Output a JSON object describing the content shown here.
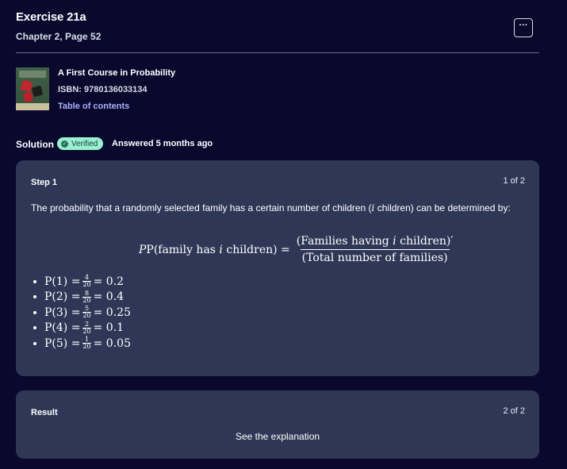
{
  "header": {
    "title": "Exercise 21a",
    "subtitle": "Chapter 2, Page 52",
    "more_label": "···"
  },
  "book": {
    "title": "A First Course in Probability",
    "isbn": "ISBN: 9780136033134",
    "toc_link": "Table of contents"
  },
  "solution": {
    "label": "Solution",
    "badge": "Verified",
    "answered": "Answered 5 months ago"
  },
  "step": {
    "title": "Step 1",
    "count": "1 of 2",
    "intro_before": "The probability that a randomly selected family has a certain number of children (",
    "intro_var": "i",
    "intro_after": " children) can be determined by:",
    "formula": {
      "lhs_a": "P(family has ",
      "lhs_var": "i",
      "lhs_b": " children) =",
      "num_a": "(Families having ",
      "num_var": "i",
      "num_b": " children)′",
      "den": "(Total number of families)"
    },
    "items": [
      {
        "lhs": "P(1) =",
        "num": "4",
        "den": "20",
        "rhs": "= 0.2"
      },
      {
        "lhs": "P(2) =",
        "num": "8",
        "den": "20",
        "rhs": "= 0.4"
      },
      {
        "lhs": "P(3) =",
        "num": "5",
        "den": "20",
        "rhs": "= 0.25"
      },
      {
        "lhs": "P(4) =",
        "num": "2",
        "den": "20",
        "rhs": "= 0.1"
      },
      {
        "lhs": "P(5) =",
        "num": "1",
        "den": "20",
        "rhs": "= 0.05"
      }
    ]
  },
  "result": {
    "title": "Result",
    "count": "2 of 2",
    "text": "See the explanation"
  },
  "colors": {
    "background": "#0a092d",
    "card": "#2e3856",
    "badge": "#98f1d1",
    "link": "#a8b1ff"
  }
}
